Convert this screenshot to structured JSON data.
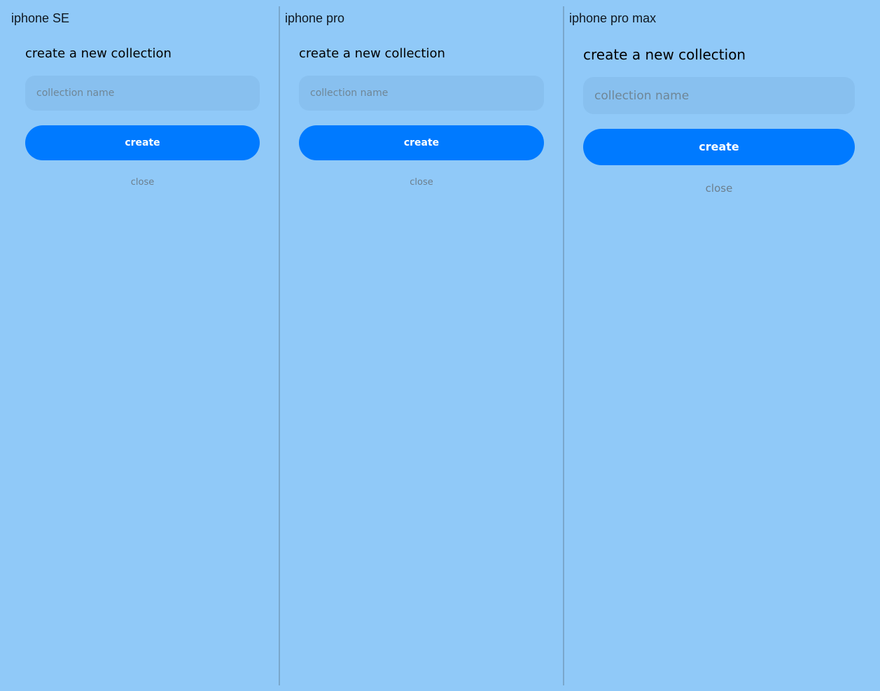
{
  "colors": {
    "background": "#90c9f8",
    "input_background": "#88c0ef",
    "button_background": "#007aff",
    "button_text": "#ffffff",
    "muted_text": "#6c7e8c"
  },
  "panels": [
    {
      "device_label": "iphone SE",
      "title": "create a new collection",
      "input": {
        "value": "",
        "placeholder": "collection name"
      },
      "create_label": "create",
      "close_label": "close"
    },
    {
      "device_label": "iphone pro",
      "title": "create a new collection",
      "input": {
        "value": "",
        "placeholder": "collection name"
      },
      "create_label": "create",
      "close_label": "close"
    },
    {
      "device_label": "iphone pro max",
      "title": "create a new collection",
      "input": {
        "value": "",
        "placeholder": "collection name"
      },
      "create_label": "create",
      "close_label": "close"
    }
  ]
}
